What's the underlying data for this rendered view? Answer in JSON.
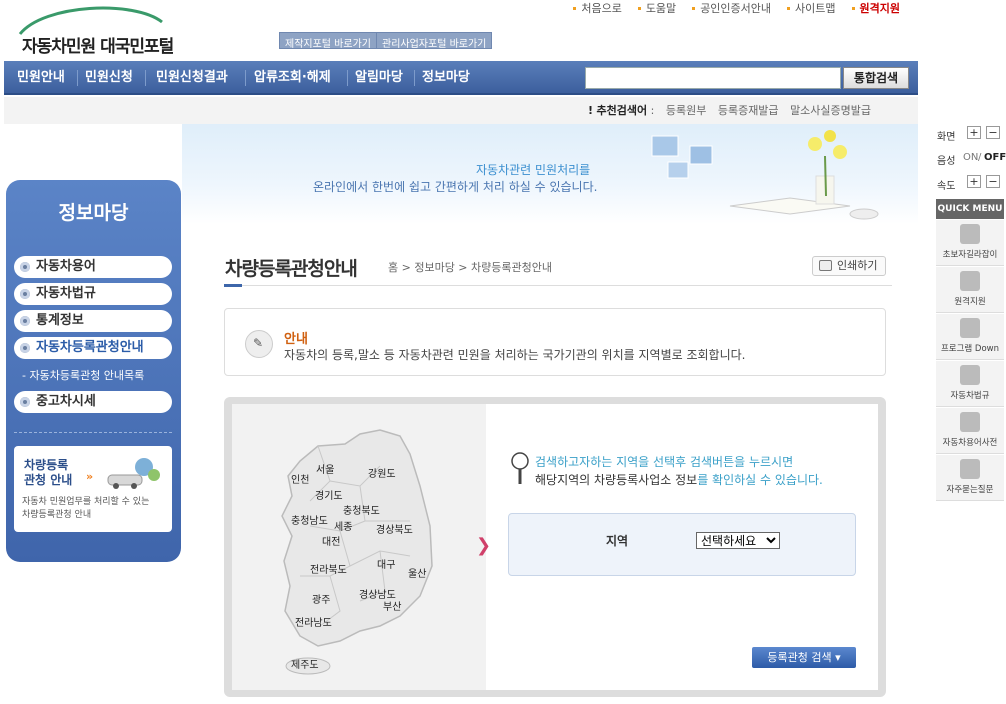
{
  "header": {
    "logo_text": "자동차민원 대국민포털",
    "quick_links": [
      "제작지포털 바로가기",
      "관리사업자포털 바로가기"
    ],
    "util_links": [
      "처음으로",
      "도움말",
      "공인인증서안내",
      "사이트맵",
      "원격지원"
    ]
  },
  "gnb": {
    "items": [
      "민원안내",
      "민원신청",
      "민원신청결과",
      "압류조회·해제",
      "알림마당",
      "정보마당"
    ],
    "search_button": "통합검색"
  },
  "recommend": {
    "label": "추천검색어",
    "keywords": [
      "등록원부",
      "등록증재발급",
      "말소사실증명발급"
    ]
  },
  "banner": {
    "line1": "자동차관련 민원처리를",
    "line2": "온라인에서 한번에 쉽고 간편하게 처리 하실 수 있습니다."
  },
  "sidebar": {
    "title": "정보마당",
    "items": [
      "자동차용어",
      "자동차법규",
      "통계정보",
      "자동차등록관청안내",
      "중고차시세"
    ],
    "sub_item": "자동차등록관청 안내목록",
    "box_title": [
      "차량등록",
      "관청 안내"
    ],
    "box_desc": [
      "자동차 민원업무를 처리할 수 있는",
      "차량등록관청 안내"
    ]
  },
  "page": {
    "title": "차량등록관청안내",
    "breadcrumb": "홈  >  정보마당  >  차량등록관청안내",
    "print_label": "인쇄하기",
    "notice_title": "안내",
    "notice_desc": "자동차의 등록,말소 등 자동차관련 민원을 처리하는 국가기관의 위치를 지역별로 조회합니다.",
    "guide_line1": "검색하고자하는 지역을 선택후 검색버튼을 누르시면",
    "guide_line2_a": "해당지역의 차량등록사업소 정보",
    "guide_line2_b": "를 확인하실 수 있습니다.",
    "form_label": "지역",
    "select_value": "선택하세요",
    "search_button": "등록관청 검색"
  },
  "map_regions": [
    "서울",
    "인천",
    "강원도",
    "경기도",
    "충청북도",
    "충청남도",
    "세종",
    "대전",
    "경상북도",
    "전라북도",
    "대구",
    "울산",
    "광주",
    "경상남도",
    "부산",
    "전라남도",
    "제주도"
  ],
  "right_panel": {
    "controls": [
      {
        "label": "화면",
        "a": "+",
        "b": "−"
      },
      {
        "label": "음성",
        "a": "ON",
        "b": "OFF"
      },
      {
        "label": "속도",
        "a": "+",
        "b": "−"
      }
    ],
    "quick_menu_title": "QUICK MENU",
    "quick_menu": [
      "초보자길라잡이",
      "원격지원",
      "프로그램 Down",
      "자동차법규",
      "자동차용어사전",
      "자주묻는질문"
    ]
  }
}
